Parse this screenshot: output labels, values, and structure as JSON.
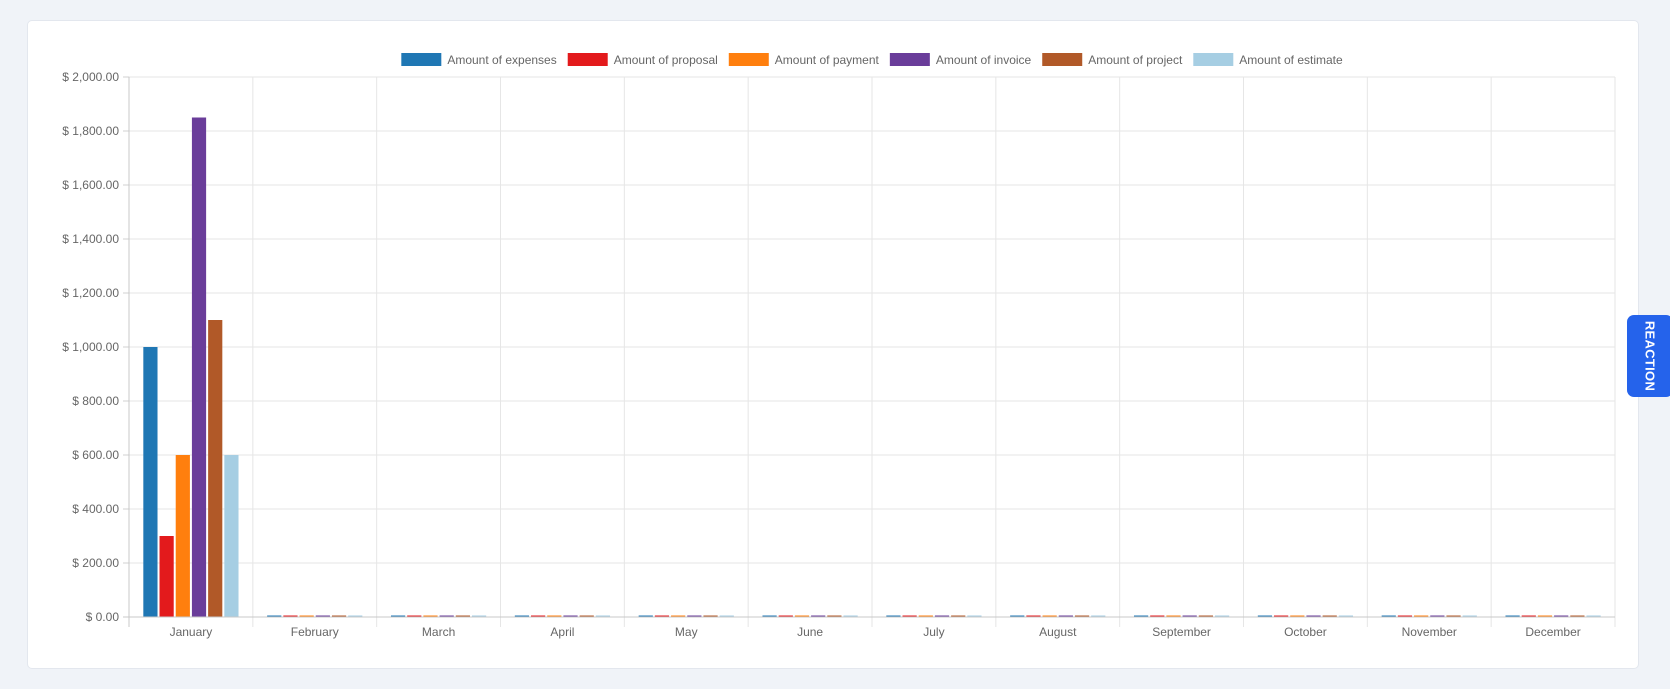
{
  "reaction_tab": {
    "label": "REACTION",
    "color": "#2563eb"
  },
  "chart_data": {
    "type": "bar",
    "title": "",
    "xlabel": "",
    "ylabel": "",
    "ylim": [
      0,
      2000
    ],
    "y_tick_step": 200,
    "y_tick_format": "$ {value}",
    "y_ticks": [
      "$ 0.00",
      "$ 200.00",
      "$ 400.00",
      "$ 600.00",
      "$ 800.00",
      "$ 1,000.00",
      "$ 1,200.00",
      "$ 1,400.00",
      "$ 1,600.00",
      "$ 1,800.00",
      "$ 2,000.00"
    ],
    "categories": [
      "January",
      "February",
      "March",
      "April",
      "May",
      "June",
      "July",
      "August",
      "September",
      "October",
      "November",
      "December"
    ],
    "legend_position": "top-center",
    "grid": true,
    "series": [
      {
        "name": "Amount of expenses",
        "color": "#1f77b4",
        "values": [
          1000,
          0,
          0,
          0,
          0,
          0,
          0,
          0,
          0,
          0,
          0,
          0
        ]
      },
      {
        "name": "Amount of proposal",
        "color": "#e31a1c",
        "values": [
          300,
          0,
          0,
          0,
          0,
          0,
          0,
          0,
          0,
          0,
          0,
          0
        ]
      },
      {
        "name": "Amount of payment",
        "color": "#ff7f0e",
        "values": [
          600,
          0,
          0,
          0,
          0,
          0,
          0,
          0,
          0,
          0,
          0,
          0
        ]
      },
      {
        "name": "Amount of invoice",
        "color": "#6a3d9a",
        "values": [
          1850,
          0,
          0,
          0,
          0,
          0,
          0,
          0,
          0,
          0,
          0,
          0
        ]
      },
      {
        "name": "Amount of project",
        "color": "#b15928",
        "values": [
          1100,
          0,
          0,
          0,
          0,
          0,
          0,
          0,
          0,
          0,
          0,
          0
        ]
      },
      {
        "name": "Amount of estimate",
        "color": "#a6cee3",
        "values": [
          600,
          0,
          0,
          0,
          0,
          0,
          0,
          0,
          0,
          0,
          0,
          0
        ]
      }
    ]
  }
}
